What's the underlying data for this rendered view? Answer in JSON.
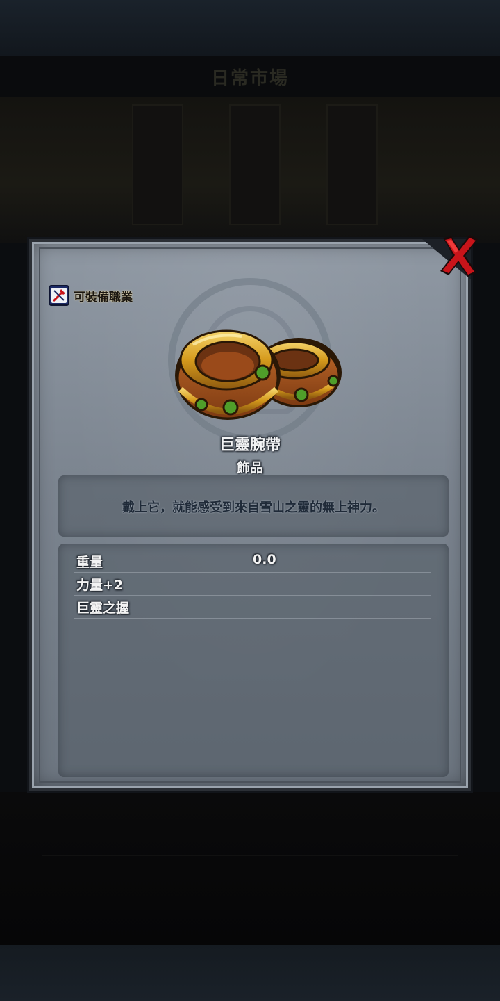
{
  "background": {
    "header_title": "日常市場",
    "lower_left": "",
    "lower_right": "",
    "lower_number": ""
  },
  "dialog": {
    "close_icon": "red-x-close-icon",
    "class_icon": "class-equip-icon",
    "class_label": "可裝備職業",
    "item_icon": "gold-bracelets-icon",
    "item_name": "巨靈腕帶",
    "item_type": "飾品",
    "description": "戴上它，就能感受到來自雪山之靈的無上神力。",
    "stats": [
      {
        "label": "重量",
        "value": "0.0"
      },
      {
        "label": "力量+2",
        "value": ""
      },
      {
        "label": "巨靈之握",
        "value": ""
      }
    ]
  },
  "colors": {
    "dialog_bg": "#7b848f",
    "close_red": "#c8141a",
    "gold": "#d59a1c",
    "gem_green": "#4f9e2a"
  }
}
